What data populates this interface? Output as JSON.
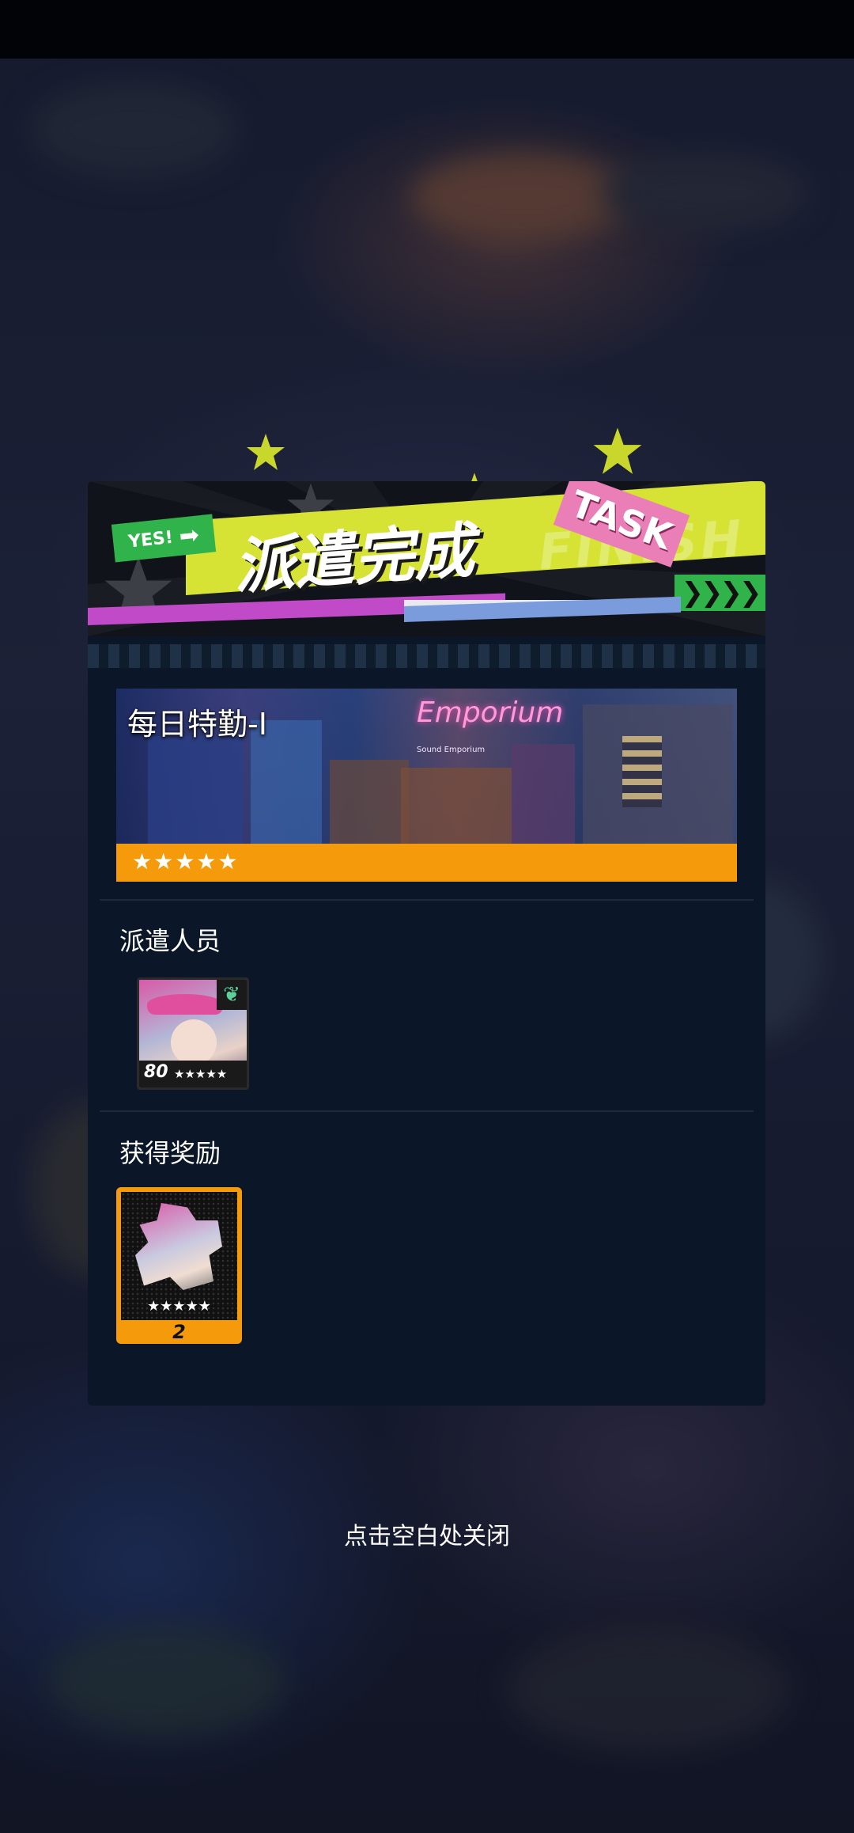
{
  "banner": {
    "yes_label": "YES!",
    "title": "派遣完成",
    "task_tag": "TASK",
    "finish_watermark": "FINISH"
  },
  "mission": {
    "name": "每日特勤-Ⅰ",
    "stars": "★★★★★",
    "scene_sign_1": "Emporium",
    "scene_sign_2": "Sound Emporium"
  },
  "crew": {
    "section_label": "派遣人员",
    "members": [
      {
        "level": "80",
        "stars": "★★★★★"
      }
    ]
  },
  "rewards": {
    "section_label": "获得奖励",
    "items": [
      {
        "stars": "★★★★★",
        "quantity": "2"
      }
    ]
  },
  "close_hint": "点击空白处关闭"
}
